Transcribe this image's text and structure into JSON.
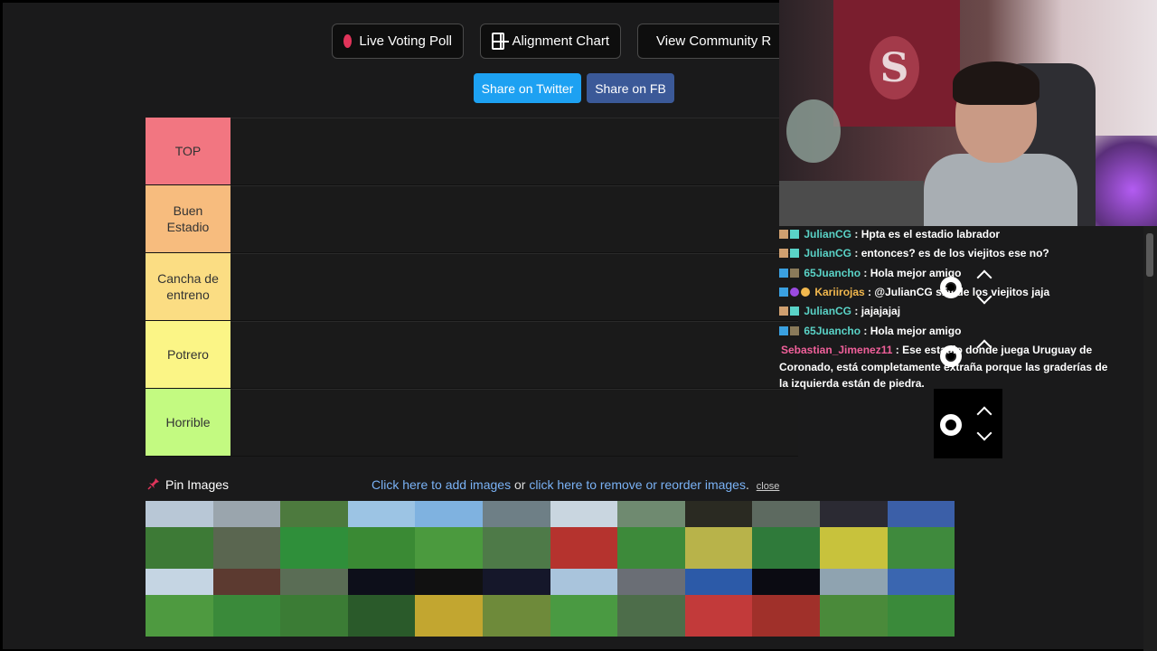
{
  "top_buttons": [
    {
      "label": "Live Voting Poll",
      "icon": "red-dot-icon"
    },
    {
      "label": "Alignment Chart",
      "icon": "grid-icon"
    },
    {
      "label": "View Community R",
      "icon": "mosaic-icon"
    }
  ],
  "share": {
    "twitter_label": "Share on Twitter",
    "fb_label": "Share on FB",
    "twitter_color": "#1da1f2",
    "fb_color": "#3b5998"
  },
  "tiers": [
    {
      "label": "TOP",
      "color": "#f27681"
    },
    {
      "label": "Buen Estadio",
      "color": "#f7bc7e"
    },
    {
      "label": "Cancha de entreno",
      "color": "#fbdd83"
    },
    {
      "label": "Potrero",
      "color": "#fbf586"
    },
    {
      "label": "Horrible",
      "color": "#c3fa81"
    }
  ],
  "pin": {
    "label": "Pin Images",
    "add_link": "Click here to add images",
    "or": " or ",
    "remove_link": "click here to remove or reorder images",
    "period": ".",
    "close": "close"
  },
  "chat": [
    {
      "user": "JulianCG",
      "text": " : Hpta es el estadio labrador",
      "color": "#5ad3c7"
    },
    {
      "user": "JulianCG",
      "text": " : entonces? es de los viejitos ese no?",
      "color": "#5ad3c7"
    },
    {
      "user": "65Juancho",
      "text": " : Hola mejor amigo",
      "color": "#5ad3c7"
    },
    {
      "user": "Kariirojas",
      "text": " : @JulianCG siiii de los viejitos jaja",
      "color": "#f2b84e"
    },
    {
      "user": "JulianCG",
      "text": " : jajajajaj",
      "color": "#5ad3c7"
    },
    {
      "user": "65Juancho",
      "text": " : Hola mejor amigo",
      "color": "#5ad3c7"
    },
    {
      "user": "Sebastian_Jimenez11",
      "text": " : Ese estadio donde juega Uruguay de Coronado, está completamente extraña porque las graderías de la izquierda están de piedra.",
      "color": "#f0609a"
    }
  ]
}
